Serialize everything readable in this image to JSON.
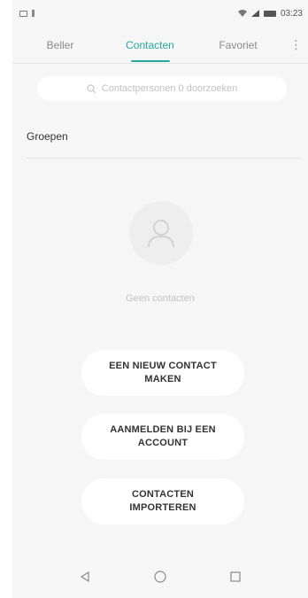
{
  "status_bar": {
    "time": "03:23"
  },
  "tabs": [
    {
      "label": "Beller",
      "active": false
    },
    {
      "label": "Contacten",
      "active": true
    },
    {
      "label": "Favoriet",
      "active": false
    }
  ],
  "accent_color": "#26a99a",
  "search": {
    "placeholder": "Contactpersonen 0 doorzoeken"
  },
  "groups_label": "Groepen",
  "empty_state": {
    "icon": "person-icon",
    "text": "Geen contacten"
  },
  "actions": [
    {
      "label": "EEN NIEUW CONTACT MAKEN"
    },
    {
      "label": "AANMELDEN BIJ EEN ACCOUNT"
    },
    {
      "label": "CONTACTEN IMPORTEREN"
    }
  ],
  "nav_bar": {
    "icons": [
      "back-icon",
      "home-icon",
      "recents-icon"
    ]
  }
}
